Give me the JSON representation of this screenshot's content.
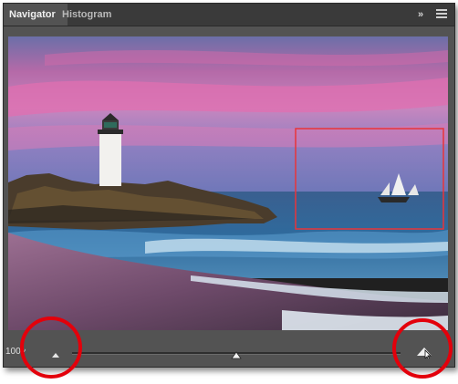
{
  "panel": {
    "tabs": [
      {
        "label": "Navigator",
        "active": true
      },
      {
        "label": "Histogram",
        "active": false
      }
    ],
    "collapse_label": "»",
    "menu_icon": "panel-menu-icon"
  },
  "navigator": {
    "zoom_value": "100%",
    "zoom_slider_level": 0.5,
    "zoom_out_icon": "small-mountain-icon",
    "zoom_in_icon": "large-mountain-icon",
    "view_box_color": "#e8353a"
  },
  "colors": {
    "panel_bg": "#535353",
    "tabbar_bg": "#3a3a3a",
    "highlight": "#e3000b"
  }
}
